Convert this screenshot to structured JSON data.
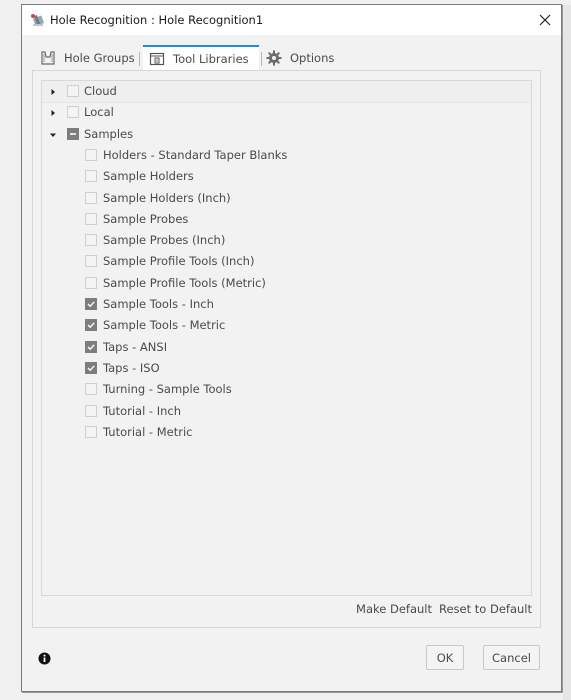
{
  "window": {
    "title": "Hole Recognition : Hole Recognition1",
    "app_icon": "hole-recognition-app-icon",
    "close_icon": "close-icon"
  },
  "tabs": [
    {
      "label": "Hole Groups",
      "icon": "hole-groups-icon",
      "active": false
    },
    {
      "label": "Tool Libraries",
      "icon": "tool-library-icon",
      "active": true
    },
    {
      "label": "Options",
      "icon": "gear-icon",
      "active": false
    }
  ],
  "tree": {
    "roots": [
      {
        "label": "Cloud",
        "expanded": false,
        "state": "unchecked"
      },
      {
        "label": "Local",
        "expanded": false,
        "state": "unchecked"
      },
      {
        "label": "Samples",
        "expanded": true,
        "state": "partial"
      }
    ],
    "children": [
      {
        "label": "Holders - Standard Taper Blanks",
        "checked": false
      },
      {
        "label": "Sample Holders",
        "checked": false
      },
      {
        "label": "Sample Holders (Inch)",
        "checked": false
      },
      {
        "label": "Sample Probes",
        "checked": false
      },
      {
        "label": "Sample Probes (Inch)",
        "checked": false
      },
      {
        "label": "Sample Profile Tools (Inch)",
        "checked": false
      },
      {
        "label": "Sample Profile Tools (Metric)",
        "checked": false
      },
      {
        "label": "Sample Tools - Inch",
        "checked": true
      },
      {
        "label": "Sample Tools - Metric",
        "checked": true
      },
      {
        "label": "Taps - ANSI",
        "checked": true
      },
      {
        "label": "Taps - ISO",
        "checked": true
      },
      {
        "label": "Turning - Sample Tools",
        "checked": false
      },
      {
        "label": "Tutorial - Inch",
        "checked": false
      },
      {
        "label": "Tutorial - Metric",
        "checked": false
      }
    ]
  },
  "links": {
    "make_default": "Make Default",
    "reset_default": "Reset to Default"
  },
  "footer": {
    "info_icon": "info-icon",
    "ok_label": "OK",
    "cancel_label": "Cancel"
  },
  "colors": {
    "accent": "#1a8fd1",
    "checkbox_checked": "#7d7d7d"
  }
}
